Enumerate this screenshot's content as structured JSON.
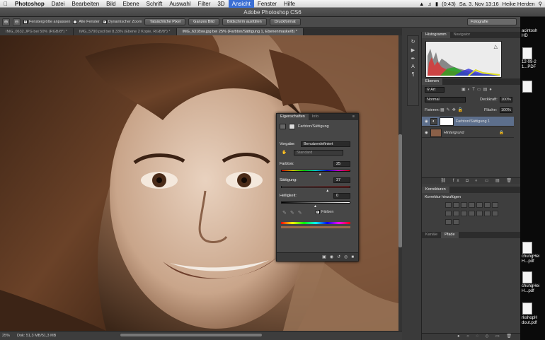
{
  "menubar": {
    "apple": "",
    "items": [
      "Photoshop",
      "Datei",
      "Bearbeiten",
      "Bild",
      "Ebene",
      "Schrift",
      "Auswahl",
      "Filter",
      "3D",
      "Ansicht",
      "Fenster",
      "Hilfe"
    ],
    "active_item": "Ansicht",
    "battery": "(0:43)",
    "clock": "Sa. 3. Nov 13:16",
    "user": "Heike Herden"
  },
  "window_title": "Adobe Photoshop CS6",
  "options_bar": {
    "chk_fit_windows": "Fenstergröße anpassen",
    "chk_all_windows": "Alle Fenster",
    "chk_dynamic_zoom": "Dynamischer Zoom",
    "btn_actual_pixels": "Tatsächliche Pixel",
    "btn_fit_screen": "Ganzes Bild",
    "btn_fill_screen": "Bildschirm ausfüllen",
    "btn_print_size": "Druckformat",
    "workspace": "Fotografie"
  },
  "tabs": [
    {
      "label": "IMG_0632.JPG bei 50% (RGB/8*) *",
      "active": false
    },
    {
      "label": "IMG_5790.psd bei 8,33% (Ebene 2 Kopie, RGB/8*) *",
      "active": false
    },
    {
      "label": "IMG_6318sw.jpg bei 25% (Farbton/Sättigung 1, Ebenenmaske/8) *",
      "active": true
    }
  ],
  "status": {
    "zoom": "25%",
    "doc": "Dok: 51,3 MB/51,3 MB"
  },
  "histogram_panel": {
    "tabs": [
      "Histogramm",
      "Navigator"
    ]
  },
  "layers_panel": {
    "tab": "Ebenen",
    "filter_kind": "Art",
    "blend_mode": "Normal",
    "opacity_label": "Deckkraft:",
    "opacity_value": "100%",
    "lock_label": "Fixieren:",
    "fill_label": "Fläche:",
    "fill_value": "100%",
    "layers": [
      {
        "name": "Farbton/Sättigung 1",
        "selected": true
      },
      {
        "name": "Hintergrund",
        "selected": false
      }
    ]
  },
  "adjustments_panel": {
    "tab": "Korrekturen",
    "title": "Korrektur hinzufügen"
  },
  "channels_panel": {
    "tabs": [
      "Kanäle",
      "Pfade"
    ]
  },
  "properties_panel": {
    "tabs": [
      "Eigenschaften",
      "Info"
    ],
    "title": "Farbton/Sättigung",
    "preset_label": "Vorgabe:",
    "preset_value": "Benutzerdefiniert",
    "channel_value": "Standard",
    "hue_label": "Farbton:",
    "hue_value": "25",
    "sat_label": "Sättigung:",
    "sat_value": "37",
    "light_label": "Helligkeit:",
    "light_value": "0",
    "colorize_label": "Färben",
    "colorize_checked": true,
    "hue_level_pct": 57,
    "sat_level_pct": 68,
    "light_level_pct": 50
  },
  "desktop": {
    "labels": [
      "acintosh",
      "HD",
      "12-09-2",
      "1...PDF",
      "chungHei",
      "H...pdf",
      "chungHei",
      "H...pdf",
      "rkshopH",
      "dout.pdf"
    ]
  },
  "colors": {
    "accent": "#3b6fd4",
    "photo_sepia": "#6a4b37"
  }
}
